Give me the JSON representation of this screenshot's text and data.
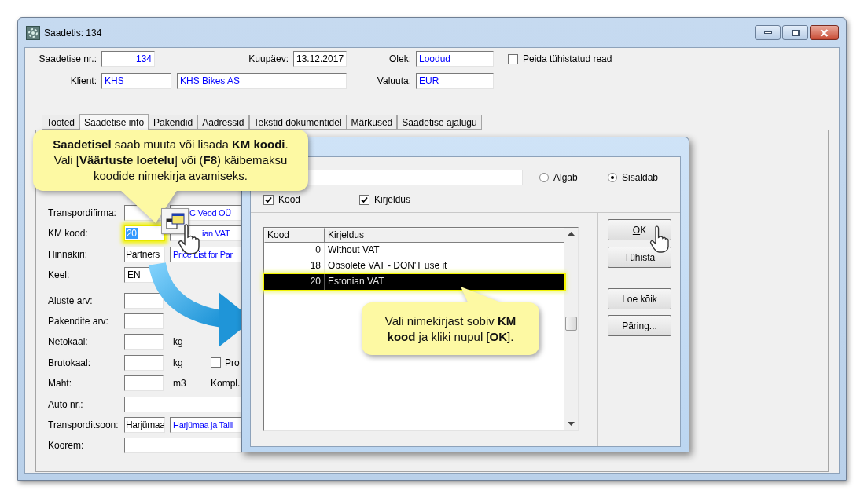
{
  "window": {
    "title": "Saadetis: 134"
  },
  "header": {
    "number": {
      "label": "Saadetise nr.:",
      "value": "134"
    },
    "date": {
      "label": "Kuupäev:",
      "value": "13.12.2017"
    },
    "status": {
      "label": "Olek:",
      "value": "Loodud"
    },
    "client": {
      "label": "Klient:",
      "code": "KHS",
      "name": "KHS Bikes AS"
    },
    "currency": {
      "label": "Valuuta:",
      "value": "EUR"
    },
    "hide_cancelled": {
      "label": "Peida tühistatud read",
      "checked": false
    }
  },
  "tabs": [
    {
      "label": "Tooted",
      "selected": false
    },
    {
      "label": "Saadetise info",
      "selected": true
    },
    {
      "label": "Pakendid",
      "selected": false
    },
    {
      "label": "Aadressid",
      "selected": false
    },
    {
      "label": "Tekstid dokumentidel",
      "selected": false
    },
    {
      "label": "Märkused",
      "selected": false
    },
    {
      "label": "Saadetise ajalugu",
      "selected": false
    }
  ],
  "form": {
    "rows": [
      {
        "kind": "lookup",
        "label": "Transpordifirma:",
        "name": "C Veod OÜ",
        "code_selected": false
      },
      {
        "kind": "lookup",
        "label": "KM kood:",
        "code": "20",
        "name": "ian VAT",
        "code_selected": true
      },
      {
        "kind": "lookup",
        "label": "Hinnakiri:",
        "code": "Partners",
        "name": "Price List for Par",
        "code_selected": false
      },
      {
        "kind": "single",
        "label": "Keel:",
        "value": "EN"
      },
      {
        "kind": "single",
        "label": "Aluste arv:"
      },
      {
        "kind": "single",
        "label": "Pakendite arv:"
      },
      {
        "kind": "unit",
        "label": "Netokaal:",
        "unit": "kg"
      },
      {
        "kind": "unit",
        "label": "Brutokaal:",
        "unit": "kg",
        "extra": {
          "kind": "checkbox",
          "label": "Pro",
          "checked": false
        }
      },
      {
        "kind": "unit",
        "label": "Maht:",
        "unit": "m3",
        "extra": {
          "kind": "text",
          "label": "Kompl."
        }
      },
      {
        "kind": "wide",
        "label": "Auto nr.:"
      },
      {
        "kind": "lookup",
        "label": "Transporditsoon:",
        "code": "Harjümaa",
        "name": "Harjümaa ja Talli",
        "code_selected": false
      },
      {
        "kind": "wide",
        "label": "Koorem:"
      }
    ]
  },
  "dialog": {
    "match_modes": [
      {
        "label": "Algab",
        "selected": false
      },
      {
        "label": "Sisaldab",
        "selected": true
      }
    ],
    "search_in": [
      {
        "label": "Kood",
        "checked": true
      },
      {
        "label": "Kirjeldus",
        "checked": true
      }
    ],
    "table": {
      "columns": [
        "Kood",
        "Kirjeldus"
      ],
      "rows": [
        {
          "code": "0",
          "description": "Without VAT",
          "selected": false
        },
        {
          "code": "18",
          "description": "Obsolete VAT - DON'T use it",
          "selected": false
        },
        {
          "code": "20",
          "description": "Estonian VAT",
          "selected": true
        }
      ]
    },
    "buttons": [
      {
        "label": "OK",
        "first_letter_underlined": true
      },
      {
        "label": "Tühista",
        "first_letter_underlined": true
      },
      {
        "label": "Loe kõik",
        "first_letter_underlined": false
      },
      {
        "label": "Päring...",
        "first_letter_underlined": false
      }
    ]
  },
  "callouts": [
    {
      "text": "**Saadetisel** saab muuta või lisada **KM koodi**. Vali [**Väärtuste loetelu**] või (**F8**) käibemaksu koodide nimekirja avamiseks."
    },
    {
      "text": "Vali nimekirjast sobiv **KM kood** ja kliki nupul [**OK**]."
    }
  ]
}
